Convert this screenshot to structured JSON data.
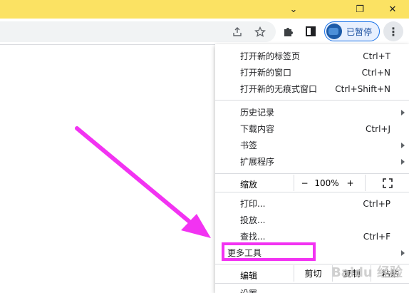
{
  "window": {
    "minimize_glyph": "⌄",
    "restore_glyph": "❐",
    "close_glyph": "✕"
  },
  "toolbar": {
    "share_icon": "share-icon",
    "star_icon": "star-icon",
    "extensions_icon": "puzzle-icon",
    "sidepanel_icon": "side-panel-icon",
    "profile_status": "已暂停",
    "menu_glyph": "⋮"
  },
  "menu": {
    "new_tab": {
      "label": "打开新的标签页",
      "shortcut": "Ctrl+T"
    },
    "new_window": {
      "label": "打开新的窗口",
      "shortcut": "Ctrl+N"
    },
    "incognito": {
      "label": "打开新的无痕式窗口",
      "shortcut": "Ctrl+Shift+N"
    },
    "history": {
      "label": "历史记录"
    },
    "downloads": {
      "label": "下载内容",
      "shortcut": "Ctrl+J"
    },
    "bookmarks": {
      "label": "书签"
    },
    "extensions": {
      "label": "扩展程序"
    },
    "zoom": {
      "label": "缩放",
      "minus": "−",
      "value": "100%",
      "plus": "+",
      "fullscreen_icon": "fullscreen-icon"
    },
    "print": {
      "label": "打印...",
      "shortcut": "Ctrl+P"
    },
    "cast": {
      "label": "投放..."
    },
    "find": {
      "label": "查找...",
      "shortcut": "Ctrl+F"
    },
    "more_tools": {
      "label": "更多工具"
    },
    "edit": {
      "label": "编辑",
      "cut": "剪切",
      "copy": "复制",
      "paste": "粘贴"
    },
    "settings": {
      "label": "设置"
    }
  },
  "annotation": {
    "highlight_color": "#f233f2"
  },
  "watermark": "Baidu 经验"
}
